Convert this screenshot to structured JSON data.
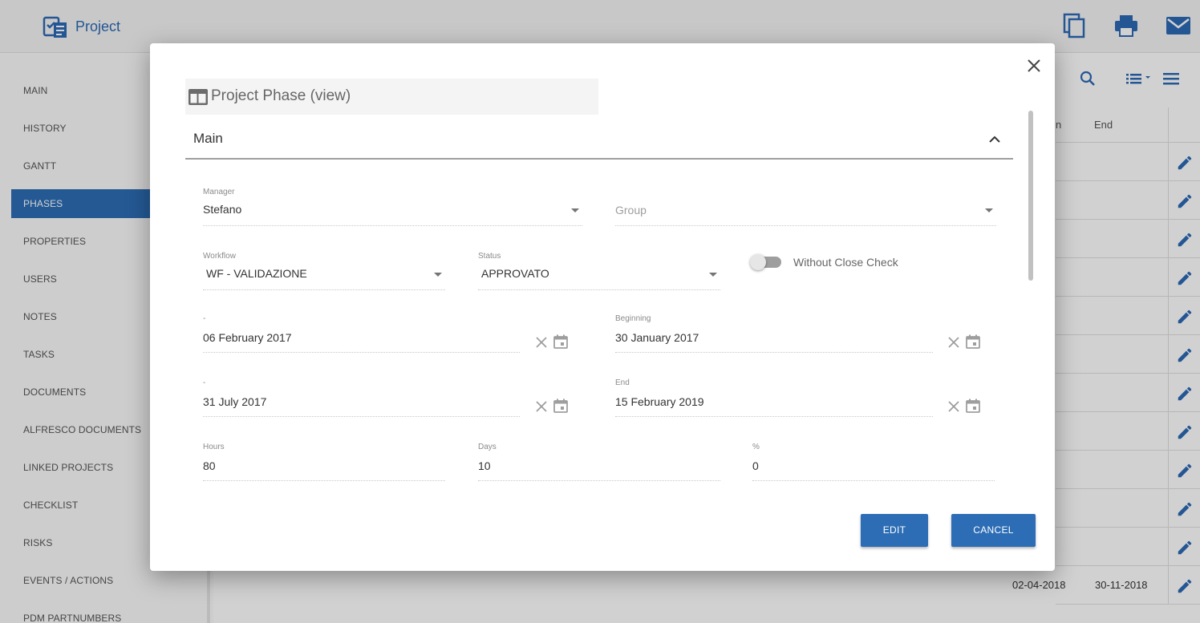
{
  "app": {
    "title": "Project"
  },
  "sidebar": {
    "items": [
      {
        "label": "MAIN"
      },
      {
        "label": "HISTORY"
      },
      {
        "label": "GANTT"
      },
      {
        "label": "PHASES",
        "active": true
      },
      {
        "label": "PROPERTIES"
      },
      {
        "label": "USERS"
      },
      {
        "label": "NOTES"
      },
      {
        "label": "TASKS"
      },
      {
        "label": "DOCUMENTS"
      },
      {
        "label": "ALFRESCO DOCUMENTS"
      },
      {
        "label": "LINKED PROJECTS"
      },
      {
        "label": "CHECKLIST"
      },
      {
        "label": "RISKS"
      },
      {
        "label": "EVENTS / ACTIONS"
      },
      {
        "label": "PDM PARTNUMBERS"
      }
    ]
  },
  "table": {
    "headers": [
      "n",
      "End"
    ],
    "last_row": {
      "start": "02-04-2018",
      "end": "30-11-2018"
    }
  },
  "modal": {
    "title": "Project Phase (view)",
    "section": "Main",
    "manager": {
      "label": "Manager",
      "value": "Stefano"
    },
    "group": {
      "placeholder": "Group"
    },
    "workflow": {
      "label": "Workflow",
      "value": "WF - VALIDAZIONE"
    },
    "status": {
      "label": "Status",
      "value": "APPROVATO"
    },
    "without_close_check": {
      "label": "Without Close Check",
      "on": false
    },
    "date_left_1": {
      "label": "-",
      "value": "06 February 2017"
    },
    "beginning": {
      "label": "Beginning",
      "value": "30 January 2017"
    },
    "date_left_2": {
      "label": "-",
      "value": "31 July 2017"
    },
    "end": {
      "label": "End",
      "value": "15 February 2019"
    },
    "hours": {
      "label": "Hours",
      "value": "80"
    },
    "days": {
      "label": "Days",
      "value": "10"
    },
    "percent": {
      "label": "%",
      "value": "0"
    },
    "edit_label": "EDIT",
    "cancel_label": "CANCEL"
  },
  "colors": {
    "primary": "#2c6db5",
    "brand": "#2c69b5"
  }
}
